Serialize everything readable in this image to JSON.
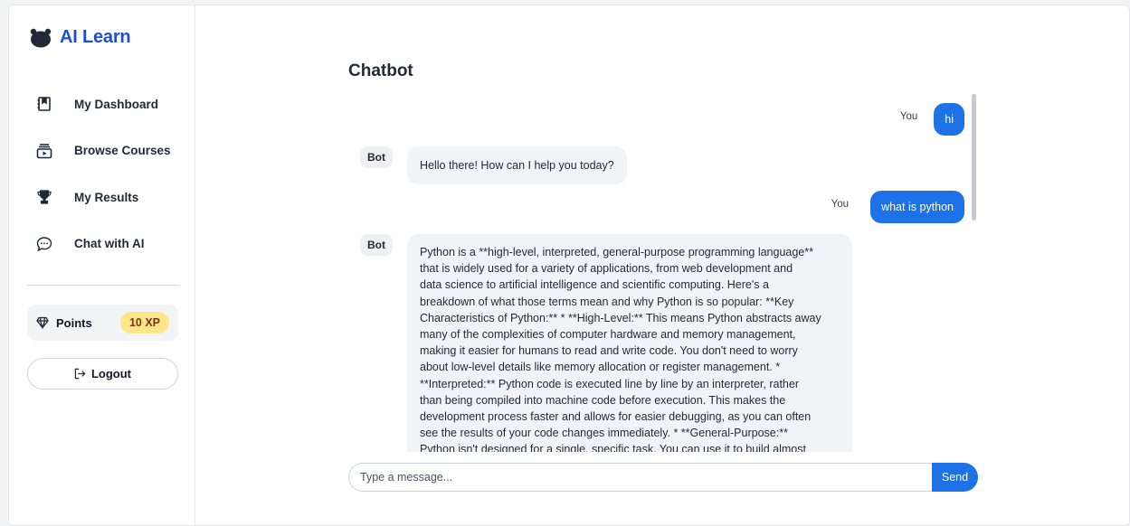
{
  "brand": {
    "name": "AI Learn",
    "icon": "graduation-cap-icon"
  },
  "sidebar": {
    "items": [
      {
        "label": "My Dashboard",
        "icon": "book-icon"
      },
      {
        "label": "Browse Courses",
        "icon": "video-icon"
      },
      {
        "label": "My Results",
        "icon": "trophy-icon"
      },
      {
        "label": "Chat with AI",
        "icon": "chat-icon"
      }
    ],
    "points_label": "Points",
    "points_value": "10 XP",
    "logout_label": "Logout"
  },
  "chat": {
    "title": "Chatbot",
    "messages": [
      {
        "sender": "You",
        "text": "hi"
      },
      {
        "sender": "Bot",
        "text": "Hello there! How can I help you today?"
      },
      {
        "sender": "You",
        "text": "what is python"
      },
      {
        "sender": "Bot",
        "lines": [
          "Python is a **high-level, interpreted, general-purpose programming language**",
          "that is widely used for a variety of applications, from web development and",
          "data science to artificial intelligence and scientific computing. Here's a",
          "breakdown of what those terms mean and why Python is so popular: **Key",
          "Characteristics of Python:** * **High-Level:** This means Python abstracts away",
          "many of the complexities of computer hardware and memory management,",
          "making it easier for humans to read and write code. You don't need to worry",
          "about low-level details like memory allocation or register management. *",
          "**Interpreted:** Python code is executed line by line by an interpreter, rather",
          "than being compiled into machine code before execution. This makes the",
          "development process faster and allows for easier debugging, as you can often",
          "see the results of your code changes immediately. * **General-Purpose:**",
          "Python isn't designed for a single, specific task. You can use it to build almost"
        ]
      }
    ],
    "input_placeholder": "Type a message...",
    "send_label": "Send"
  },
  "colors": {
    "accent": "#1d72e8",
    "brand": "#1d4ed8",
    "xp_badge": "#fde68a"
  }
}
